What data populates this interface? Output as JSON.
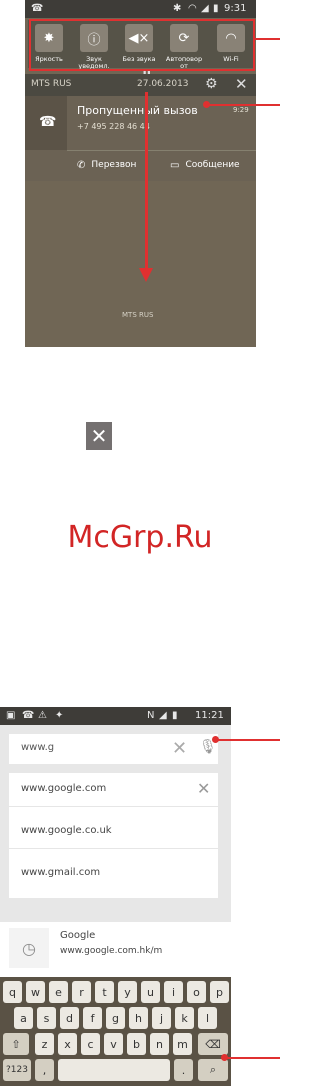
{
  "screen1": {
    "status_time": "9:31",
    "quick_settings": [
      {
        "label": "Яркость",
        "icon": "brightness-icon",
        "glyph": "✸"
      },
      {
        "label": "Звук уведомл.",
        "icon": "info-icon",
        "glyph": "ⓘ"
      },
      {
        "label": "Без звука",
        "icon": "mute-icon",
        "glyph": "🔇"
      },
      {
        "label": "Автоповор от",
        "icon": "auto-rotate-icon",
        "glyph": "⟳"
      },
      {
        "label": "Wi-Fi",
        "icon": "wifi-icon",
        "glyph": "◠"
      }
    ],
    "operator": "MTS RUS",
    "date": "27.06.2013",
    "notification": {
      "title": "Пропущенный вызов",
      "number": "+7 495 228 46 44",
      "time": "9:29",
      "callback": "Перезвон",
      "message": "Сообщение"
    },
    "footer_operator": "MTS RUS"
  },
  "middle": {
    "watermark": "McGrp.Ru"
  },
  "screen2": {
    "status_time": "11:21",
    "url_input": "www.g",
    "suggestions": [
      "www.google.com",
      "www.google.co.uk",
      "www.gmail.com"
    ],
    "history": {
      "title": "Google",
      "url": "www.google.com.hk/m"
    },
    "keyboard": {
      "row1": [
        "q",
        "w",
        "e",
        "r",
        "t",
        "y",
        "u",
        "i",
        "o",
        "p"
      ],
      "row2": [
        "a",
        "s",
        "d",
        "f",
        "g",
        "h",
        "j",
        "k",
        "l"
      ],
      "row3": [
        "z",
        "x",
        "c",
        "v",
        "b",
        "n",
        "m"
      ],
      "row4_left": "?123",
      "row4_comma": ",",
      "row4_dot": "."
    }
  },
  "colors": {
    "accent": "#e03030",
    "panel": "#706655",
    "keyboard": "#5a5245"
  }
}
